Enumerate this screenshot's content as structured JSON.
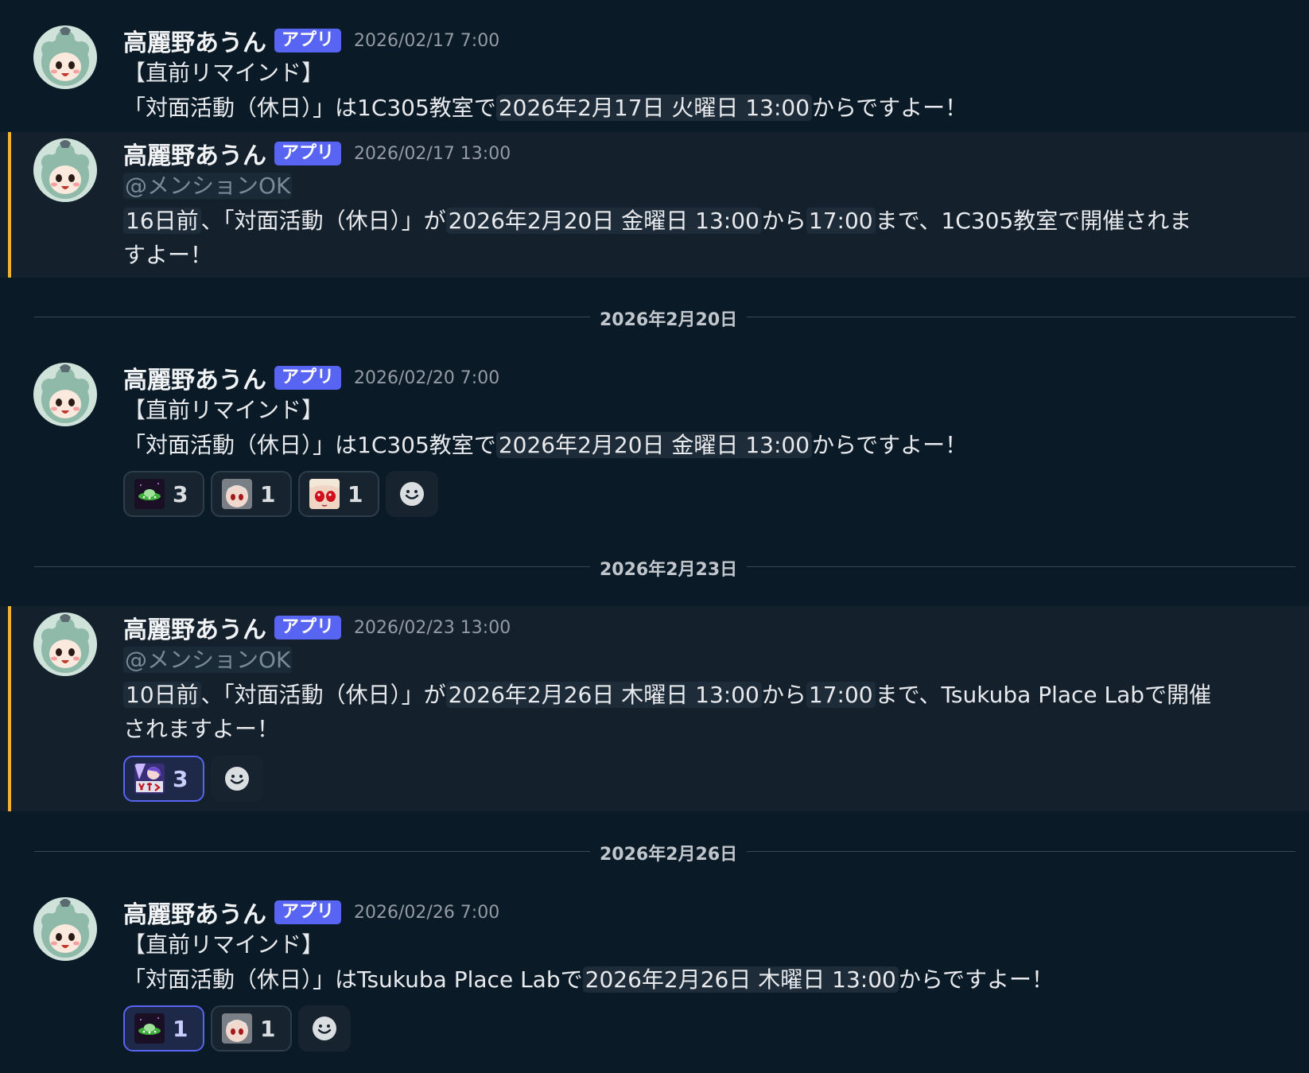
{
  "user": {
    "name": "高麗野あうん",
    "tag": "アプリ"
  },
  "messages": [
    {
      "timestamp": "2026/02/17 7:00",
      "line1": "【直前リマインド】",
      "l2a": "「対面活動（休日）」は1C305教室で",
      "l2b": "2026年2月17日 火曜日 13:00",
      "l2c": "からですよー！"
    },
    {
      "timestamp": "2026/02/17 13:00",
      "mention": "@メンションOK",
      "p1": "16日前",
      "p2": "、「対面活動（休日）」が",
      "p3": "2026年2月20日 金曜日 13:00",
      "p4": "から",
      "p5": "17:00",
      "p6": "まで、1C305教室で開催されま",
      "p7": "すよー！"
    },
    {
      "timestamp": "2026/02/20 7:00",
      "line1": "【直前リマインド】",
      "l2a": "「対面活動（休日）」は1C305教室で",
      "l2b": "2026年2月20日 金曜日 13:00",
      "l2c": "からですよー！",
      "reactions": [
        {
          "emoji": "ufo-emoji",
          "count": "3"
        },
        {
          "emoji": "character-face-emoji",
          "count": "1"
        },
        {
          "emoji": "red-eyed-face-emoji",
          "count": "1"
        }
      ]
    },
    {
      "timestamp": "2026/02/23 13:00",
      "mention": "@メンションOK",
      "p1": "10日前",
      "p2": "、「対面活動（休日）」が",
      "p3": "2026年2月26日 木曜日 13:00",
      "p4": "から",
      "p5": "17:00",
      "p6": "まで、Tsukuba Place Labで開催",
      "p7": "されますよー！",
      "reactions": [
        {
          "emoji": "iku-sticker-emoji",
          "count": "3"
        }
      ]
    },
    {
      "timestamp": "2026/02/26 7:00",
      "line1": "【直前リマインド】",
      "l2a": "「対面活動（休日）」はTsukuba Place Labで",
      "l2b": "2026年2月26日 木曜日 13:00",
      "l2c": "からですよー！",
      "reactions": [
        {
          "emoji": "ufo-emoji",
          "count": "1"
        },
        {
          "emoji": "character-face-emoji",
          "count": "1"
        }
      ]
    }
  ],
  "dividers": [
    "2026年2月20日",
    "2026年2月23日",
    "2026年2月26日"
  ],
  "colors": {
    "background": "#0a1a26",
    "highlight": "#14212d",
    "mention_bar": "#f0b232",
    "app_tag": "#5865f2"
  }
}
